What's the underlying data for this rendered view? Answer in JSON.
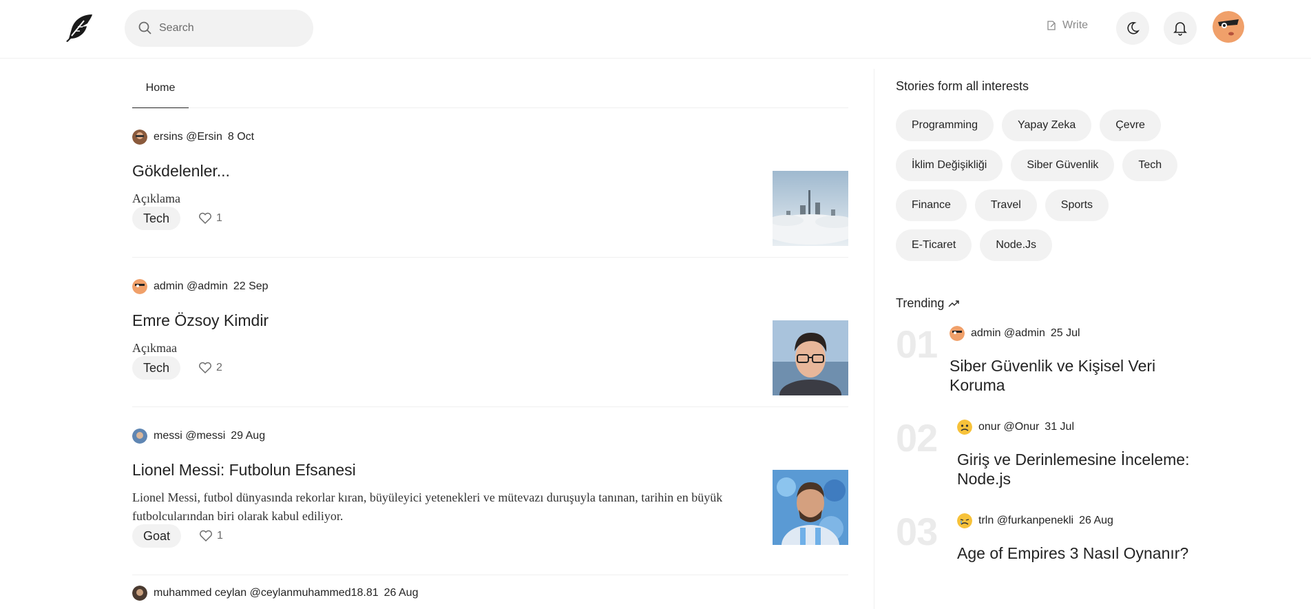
{
  "header": {
    "search_placeholder": "Search",
    "write_label": "Write"
  },
  "tabs": [
    "Home"
  ],
  "posts": [
    {
      "author": "ersins",
      "handle": "@Ersin",
      "date": "8 Oct",
      "title": "Gökdelenler...",
      "description": "Açıklama",
      "tag": "Tech",
      "likes": "1",
      "image": "city-in-clouds"
    },
    {
      "author": "admin",
      "handle": "@admin",
      "date": "22 Sep",
      "title": "Emre Özsoy Kimdir",
      "description": "Açıkmaa",
      "tag": "Tech",
      "likes": "2",
      "image": "portrait-man-glasses"
    },
    {
      "author": "messi",
      "handle": "@messi",
      "date": "29 Aug",
      "title": "Lionel Messi: Futbolun Efsanesi",
      "description": "Lionel Messi, futbol dünyasında rekorlar kıran, büyüleyici yetenekleri ve mütevazı duruşuyla tanınan, tarihin en büyük futbolcularından biri olarak kabul ediliyor.",
      "tag": "Goat",
      "likes": "1",
      "image": "messi-painting"
    },
    {
      "author": "muhammed ceylan",
      "handle": "@ceylanmuhammed18.81",
      "date": "26 Aug"
    }
  ],
  "sidebar": {
    "topics_title": "Stories form all interests",
    "topics": [
      "Programming",
      "Yapay Zeka",
      "Çevre",
      "İklim Değişikliği",
      "Siber Güvenlik",
      "Tech",
      "Finance",
      "Travel",
      "Sports",
      "E-Ticaret",
      "Node.Js"
    ],
    "trending_title": "Trending",
    "trending": [
      {
        "rank": "01",
        "author": "admin",
        "handle": "@admin",
        "date": "25 Jul",
        "title": "Siber Güvenlik ve Kişisel Veri Koruma"
      },
      {
        "rank": "02",
        "author": "onur",
        "handle": "@Onur",
        "date": "31 Jul",
        "title": "Giriş ve Derinlemesine İnceleme: Node.js"
      },
      {
        "rank": "03",
        "author": "trln",
        "handle": "@furkanpenekli",
        "date": "26 Aug",
        "title": "Age of Empires 3 Nasıl Oynanır?"
      }
    ]
  },
  "colors": {
    "pill_bg": "#f2f2f2",
    "text": "#242424",
    "muted": "#6b6b6b"
  }
}
